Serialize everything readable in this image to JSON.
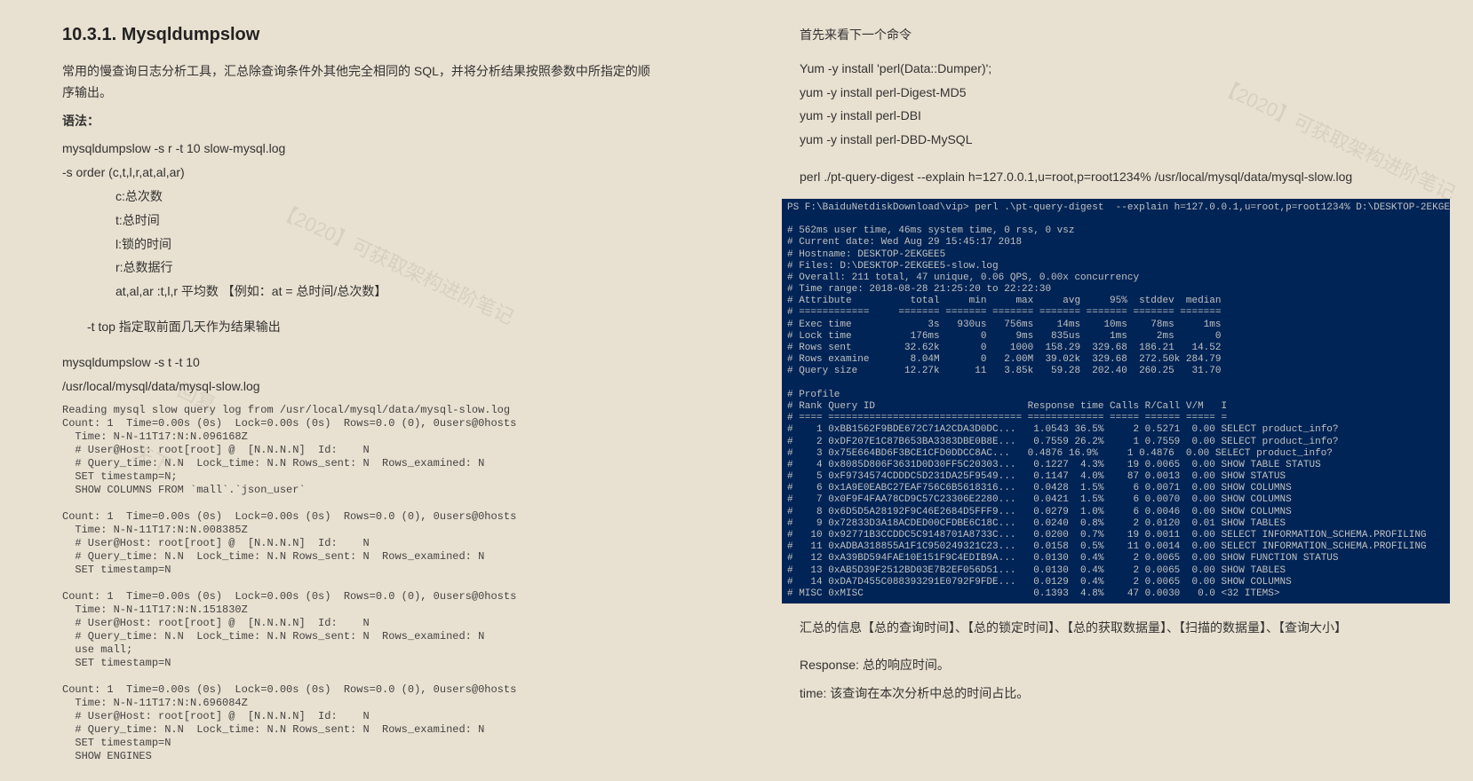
{
  "left": {
    "heading": "10.3.1.    Mysqldumpslow",
    "intro": "常用的慢查询日志分析工具，汇总除查询条件外其他完全相同的 SQL，并将分析结果按照参数中所指定的顺序输出。",
    "syntax_label": "语法：",
    "cmd1": "mysqldumpslow -s r -t 10 slow-mysql.log",
    "order_line": "-s order (c,t,l,r,at,al,ar)",
    "opts": {
      "c": "c:总次数",
      "t": "t:总时间",
      "l": "l:锁的时间",
      "r": "r:总数据行",
      "avg": "at,al,ar   :t,l,r 平均数    【例如：at = 总时间/总次数】"
    },
    "t_opt": "  -t   top    指定取前面几天作为结果输出",
    "cmd2a": "mysqldumpslow -s t -t 10",
    "cmd2b": "/usr/local/mysql/data/mysql-slow.log",
    "output": "Reading mysql slow query log from /usr/local/mysql/data/mysql-slow.log\nCount: 1  Time=0.00s (0s)  Lock=0.00s (0s)  Rows=0.0 (0), 0users@0hosts\n  Time: N-N-11T17:N:N.096168Z\n  # User@Host: root[root] @  [N.N.N.N]  Id:    N\n  # Query_time: N.N  Lock_time: N.N Rows_sent: N  Rows_examined: N\n  SET timestamp=N;\n  SHOW COLUMNS FROM `mall`.`json_user`\n\nCount: 1  Time=0.00s (0s)  Lock=0.00s (0s)  Rows=0.0 (0), 0users@0hosts\n  Time: N-N-11T17:N:N.008385Z\n  # User@Host: root[root] @  [N.N.N.N]  Id:    N\n  # Query_time: N.N  Lock_time: N.N Rows_sent: N  Rows_examined: N\n  SET timestamp=N\n\nCount: 1  Time=0.00s (0s)  Lock=0.00s (0s)  Rows=0.0 (0), 0users@0hosts\n  Time: N-N-11T17:N:N.151830Z\n  # User@Host: root[root] @  [N.N.N.N]  Id:    N\n  # Query_time: N.N  Lock_time: N.N Rows_sent: N  Rows_examined: N\n  use mall;\n  SET timestamp=N\n\nCount: 1  Time=0.00s (0s)  Lock=0.00s (0s)  Rows=0.0 (0), 0users@0hosts\n  Time: N-N-11T17:N:N.696084Z\n  # User@Host: root[root] @  [N.N.N.N]  Id:    N\n  # Query_time: N.N  Lock_time: N.N Rows_sent: N  Rows_examined: N\n  SET timestamp=N\n  SHOW ENGINES"
  },
  "right": {
    "intro": "首先来看下一个命令",
    "yum1": "Yum -y   install 'perl(Data::Dumper)';",
    "yum2": "yum -y install perl-Digest-MD5",
    "yum3": "yum -y install perl-DBI",
    "yum4": "yum -y install perl-DBD-MySQL",
    "perl_cmd": "perl    ./pt-query-digest         --explain    h=127.0.0.1,u=root,p=root1234% /usr/local/mysql/data/mysql-slow.log",
    "summary1": "汇总的信息【总的查询时间】、【总的锁定时间】、【总的获取数据量】、【扫描的数据量】、【查询大小】",
    "summary2": "Response: 总的响应时间。",
    "summary3": "time: 该查询在本次分析中总的时间占比。",
    "terminal": "PS F:\\BaiduNetdiskDownload\\vip> perl .\\pt-query-digest  --explain h=127.0.0.1,u=root,p=root1234% D:\\DESKTOP-2EKGEE5-slow.log\n\n# 562ms user time, 46ms system time, 0 rss, 0 vsz\n# Current date: Wed Aug 29 15:45:17 2018\n# Hostname: DESKTOP-2EKGEE5\n# Files: D:\\DESKTOP-2EKGEE5-slow.log\n# Overall: 211 total, 47 unique, 0.06 QPS, 0.00x concurrency\n# Time range: 2018-08-28 21:25:20 to 22:22:30\n# Attribute          total     min     max     avg     95%  stddev  median\n# ============     ======= ======= ======= ======= ======= ======= =======\n# Exec time             3s   930us   756ms    14ms    10ms    78ms     1ms\n# Lock time          176ms       0     9ms   835us     1ms     2ms       0\n# Rows sent         32.62k       0    1000  158.29  329.68  186.21   14.52\n# Rows examine       8.04M       0   2.00M  39.02k  329.68  272.50k 284.79\n# Query size        12.27k      11   3.85k   59.28  202.40  260.25   31.70\n\n# Profile\n# Rank Query ID                          Response time Calls R/Call V/M   I\n# ==== ================================= ============= ===== ====== ===== =\n#    1 0xBB1562F9BDE672C71A2CDA3D0DC...   1.0543 36.5%     2 0.5271  0.00 SELECT product_info?\n#    2 0xDF207E1C87B653BA3383DBE0B8E...   0.7559 26.2%     1 0.7559  0.00 SELECT product_info?\n#    3 0x75E664BD6F3BCE1CFD0DDCC8AC...   0.4876 16.9%     1 0.4876  0.00 SELECT product_info?\n#    4 0x8085D806F3631D0D30FF5C20303...   0.1227  4.3%    19 0.0065  0.00 SHOW TABLE STATUS\n#    5 0xF9734574CDDDC5D231DA25F9549...   0.1147  4.0%    87 0.0013  0.00 SHOW STATUS\n#    6 0x1A9E0EABC27EAF756C6B5618316...   0.0428  1.5%     6 0.0071  0.00 SHOW COLUMNS\n#    7 0x0F9F4FAA78CD9C57C23306E2280...   0.0421  1.5%     6 0.0070  0.00 SHOW COLUMNS\n#    8 0x6D5D5A28192F9C46E2684D5FFF9...   0.0279  1.0%     6 0.0046  0.00 SHOW COLUMNS\n#    9 0x72833D3A18ACDED00CFDBE6C18C...   0.0240  0.8%     2 0.0120  0.01 SHOW TABLES\n#   10 0x92771B3CCDDC5C9148701A8733C...   0.0200  0.7%    19 0.0011  0.00 SELECT INFORMATION_SCHEMA.PROFILING\n#   11 0xADBA318855A1F1C950249321C23...   0.0158  0.5%    11 0.0014  0.00 SELECT INFORMATION_SCHEMA.PROFILING\n#   12 0xA39BD594FAE10E151F9C4EDIB9A...   0.0130  0.4%     2 0.0065  0.00 SHOW FUNCTION STATUS\n#   13 0xAB5D39F2512BD03E7B2EF056D51...   0.0130  0.4%     2 0.0065  0.00 SHOW TABLES\n#   14 0xDA7D455C088393291E0792F9FDE...   0.0129  0.4%     2 0.0065  0.00 SHOW COLUMNS\n# MISC 0xMISC                             0.1393  4.8%    47 0.0030   0.0 <32 ITEMS>"
  },
  "watermarks": [
    "【2020】可获取架构进阶笔记",
    "回复",
    "天下"
  ]
}
